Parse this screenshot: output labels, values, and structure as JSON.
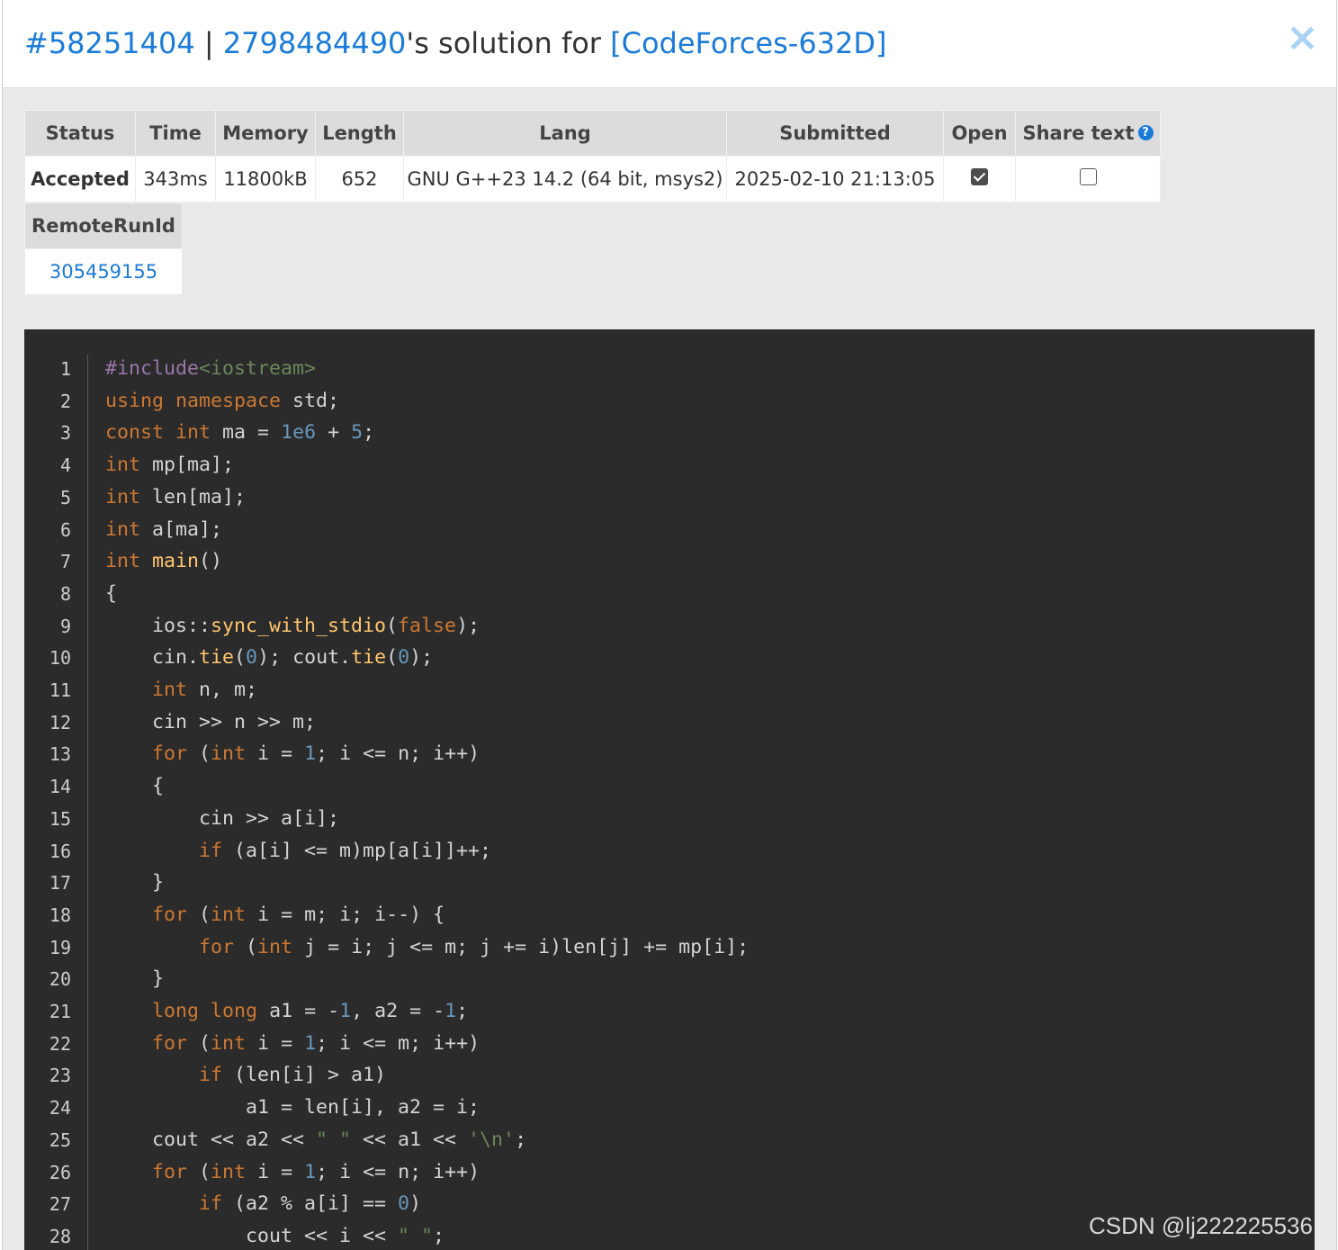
{
  "modal": {
    "submission_id": "#58251404",
    "separator": " | ",
    "user": "2798484490",
    "title_middle": "'s solution for ",
    "problem": "[CodeForces-632D]",
    "close_symbol": "×"
  },
  "info_table": {
    "headers": [
      "Status",
      "Time",
      "Memory",
      "Length",
      "Lang",
      "Submitted",
      "Open",
      "Share text"
    ],
    "values": {
      "status": "Accepted",
      "time": "343ms",
      "memory": "11800kB",
      "length": "652",
      "lang": "GNU G++23 14.2 (64 bit, msys2)",
      "submitted": "2025-02-10 21:13:05",
      "open_checked": true,
      "share_checked": false
    },
    "help_symbol": "?"
  },
  "remote_table": {
    "header": "RemoteRunId",
    "value": "305459155"
  },
  "code": {
    "lines": [
      [
        [
          "pp",
          "#include"
        ],
        [
          "str",
          "<iostream>"
        ]
      ],
      [
        [
          "kw",
          "using"
        ],
        [
          "t",
          " "
        ],
        [
          "kw",
          "namespace"
        ],
        [
          "t",
          " std;"
        ]
      ],
      [
        [
          "kw",
          "const"
        ],
        [
          "t",
          " "
        ],
        [
          "kw",
          "int"
        ],
        [
          "t",
          " ma = "
        ],
        [
          "num",
          "1e6"
        ],
        [
          "t",
          " + "
        ],
        [
          "num",
          "5"
        ],
        [
          "t",
          ";"
        ]
      ],
      [
        [
          "kw",
          "int"
        ],
        [
          "t",
          " mp[ma];"
        ]
      ],
      [
        [
          "kw",
          "int"
        ],
        [
          "t",
          " len[ma];"
        ]
      ],
      [
        [
          "kw",
          "int"
        ],
        [
          "t",
          " a[ma];"
        ]
      ],
      [
        [
          "kw",
          "int"
        ],
        [
          "t",
          " "
        ],
        [
          "fn",
          "main"
        ],
        [
          "t",
          "()"
        ]
      ],
      [
        [
          "t",
          "{"
        ]
      ],
      [
        [
          "t",
          "    ios::"
        ],
        [
          "fn",
          "sync_with_stdio"
        ],
        [
          "t",
          "("
        ],
        [
          "kw",
          "false"
        ],
        [
          "t",
          ");"
        ]
      ],
      [
        [
          "t",
          "    cin."
        ],
        [
          "fn",
          "tie"
        ],
        [
          "t",
          "("
        ],
        [
          "num",
          "0"
        ],
        [
          "t",
          "); cout."
        ],
        [
          "fn",
          "tie"
        ],
        [
          "t",
          "("
        ],
        [
          "num",
          "0"
        ],
        [
          "t",
          ");"
        ]
      ],
      [
        [
          "t",
          "    "
        ],
        [
          "kw",
          "int"
        ],
        [
          "t",
          " n, m;"
        ]
      ],
      [
        [
          "t",
          "    cin >> n >> m;"
        ]
      ],
      [
        [
          "t",
          "    "
        ],
        [
          "kw",
          "for"
        ],
        [
          "t",
          " ("
        ],
        [
          "kw",
          "int"
        ],
        [
          "t",
          " i = "
        ],
        [
          "num",
          "1"
        ],
        [
          "t",
          "; i <= n; i++)"
        ]
      ],
      [
        [
          "t",
          "    {"
        ]
      ],
      [
        [
          "t",
          "        cin >> a[i];"
        ]
      ],
      [
        [
          "t",
          "        "
        ],
        [
          "kw",
          "if"
        ],
        [
          "t",
          " (a[i] <= m)mp[a[i]]++;"
        ]
      ],
      [
        [
          "t",
          "    }"
        ]
      ],
      [
        [
          "t",
          "    "
        ],
        [
          "kw",
          "for"
        ],
        [
          "t",
          " ("
        ],
        [
          "kw",
          "int"
        ],
        [
          "t",
          " i = m; i; i--) {"
        ]
      ],
      [
        [
          "t",
          "        "
        ],
        [
          "kw",
          "for"
        ],
        [
          "t",
          " ("
        ],
        [
          "kw",
          "int"
        ],
        [
          "t",
          " j = i; j <= m; j += i)len[j] += mp[i];"
        ]
      ],
      [
        [
          "t",
          "    }"
        ]
      ],
      [
        [
          "t",
          "    "
        ],
        [
          "kw",
          "long"
        ],
        [
          "t",
          " "
        ],
        [
          "kw",
          "long"
        ],
        [
          "t",
          " a1 = -"
        ],
        [
          "num",
          "1"
        ],
        [
          "t",
          ", a2 = -"
        ],
        [
          "num",
          "1"
        ],
        [
          "t",
          ";"
        ]
      ],
      [
        [
          "t",
          "    "
        ],
        [
          "kw",
          "for"
        ],
        [
          "t",
          " ("
        ],
        [
          "kw",
          "int"
        ],
        [
          "t",
          " i = "
        ],
        [
          "num",
          "1"
        ],
        [
          "t",
          "; i <= m; i++)"
        ]
      ],
      [
        [
          "t",
          "        "
        ],
        [
          "kw",
          "if"
        ],
        [
          "t",
          " (len[i] > a1)"
        ]
      ],
      [
        [
          "t",
          "            a1 = len[i], a2 = i;"
        ]
      ],
      [
        [
          "t",
          "    cout << a2 << "
        ],
        [
          "str",
          "\" \""
        ],
        [
          "t",
          " << a1 << "
        ],
        [
          "str",
          "'\\n'"
        ],
        [
          "t",
          ";"
        ]
      ],
      [
        [
          "t",
          "    "
        ],
        [
          "kw",
          "for"
        ],
        [
          "t",
          " ("
        ],
        [
          "kw",
          "int"
        ],
        [
          "t",
          " i = "
        ],
        [
          "num",
          "1"
        ],
        [
          "t",
          "; i <= n; i++)"
        ]
      ],
      [
        [
          "t",
          "        "
        ],
        [
          "kw",
          "if"
        ],
        [
          "t",
          " (a2 % a[i] == "
        ],
        [
          "num",
          "0"
        ],
        [
          "t",
          ")"
        ]
      ],
      [
        [
          "t",
          "            cout << i << "
        ],
        [
          "str",
          "\" \""
        ],
        [
          "t",
          ";"
        ]
      ]
    ]
  },
  "watermark": "CSDN @lj222225536",
  "colors": {
    "link": "#1a7bd8",
    "accepted": "#4cae4c",
    "code_bg": "#2b2b2b",
    "keyword": "#cc7832",
    "number": "#6897bb",
    "string": "#6a8759",
    "function": "#ffc66d",
    "preprocessor": "#9876aa"
  }
}
